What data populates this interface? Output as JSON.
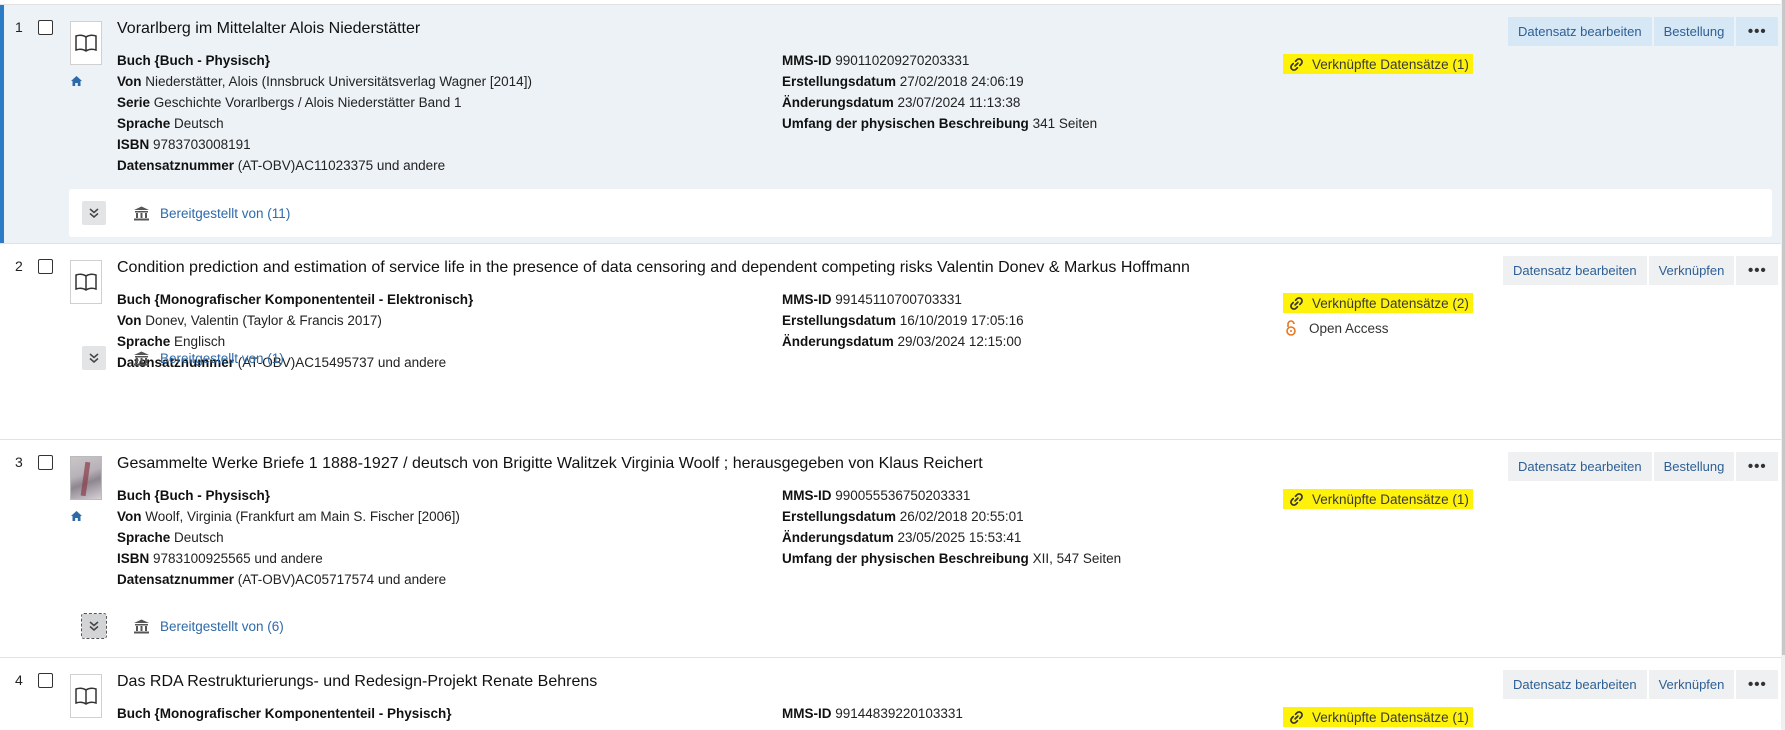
{
  "records": [
    {
      "number": "1",
      "title": "Vorarlberg im Mittelalter Alois Niederstätter",
      "left_fields": [
        {
          "label": "Buch {Buch - Physisch}",
          "value": ""
        },
        {
          "label": "Von",
          "value": "Niederstätter, Alois (Innsbruck Universitätsverlag Wagner [2014])"
        },
        {
          "label": "Serie",
          "value": "Geschichte Vorarlbergs / Alois Niederstätter Band 1"
        },
        {
          "label": "Sprache",
          "value": "Deutsch"
        },
        {
          "label": "ISBN",
          "value": "9783703008191"
        },
        {
          "label": "Datensatznummer",
          "value": "(AT-OBV)AC11023375 und andere"
        }
      ],
      "mid_fields": [
        {
          "label": "MMS-ID",
          "value": "990110209270203331"
        },
        {
          "label": "Erstellungsdatum",
          "value": "27/02/2018 24:06:19"
        },
        {
          "label": "Änderungsdatum",
          "value": "23/07/2024 11:13:38"
        },
        {
          "label": "Umfang der physischen Beschreibung",
          "value": "341 Seiten"
        }
      ],
      "linked": "Verknüpfte Datensätze (1)",
      "actions": [
        "Datensatz bearbeiten",
        "Bestellung",
        "•••"
      ],
      "provided_by": "Bereitgestellt von (11)"
    },
    {
      "number": "2",
      "title": "Condition prediction and estimation of service life in the presence of data censoring and dependent competing risks Valentin Donev & Markus Hoffmann",
      "left_fields": [
        {
          "label": "Buch {Monografischer Komponententeil - Elektronisch}",
          "value": ""
        },
        {
          "label": "Von",
          "value": "Donev, Valentin (Taylor & Francis 2017)"
        },
        {
          "label": "Sprache",
          "value": "Englisch"
        },
        {
          "label": "Datensatznummer",
          "value": "(AT-OBV)AC15495737 und andere"
        }
      ],
      "mid_fields": [
        {
          "label": "MMS-ID",
          "value": "99145110700703331"
        },
        {
          "label": "Erstellungsdatum",
          "value": "16/10/2019 17:05:16"
        },
        {
          "label": "Änderungsdatum",
          "value": "29/03/2024 12:15:00"
        }
      ],
      "linked": "Verknüpfte Datensätze (2)",
      "open_access": "Open Access",
      "actions": [
        "Datensatz bearbeiten",
        "Verknüpfen",
        "•••"
      ],
      "provided_by": "Bereitgestellt von (1)"
    },
    {
      "number": "3",
      "title": "Gesammelte Werke Briefe 1 1888-1927 / deutsch von Brigitte Walitzek Virginia Woolf ; herausgegeben von Klaus Reichert",
      "left_fields": [
        {
          "label": "Buch {Buch - Physisch}",
          "value": ""
        },
        {
          "label": "Von",
          "value": "Woolf, Virginia (Frankfurt am Main S. Fischer [2006])"
        },
        {
          "label": "Sprache",
          "value": "Deutsch"
        },
        {
          "label": "ISBN",
          "value": "9783100925565 und andere"
        },
        {
          "label": "Datensatznummer",
          "value": "(AT-OBV)AC05717574 und andere"
        }
      ],
      "mid_fields": [
        {
          "label": "MMS-ID",
          "value": "990055536750203331"
        },
        {
          "label": "Erstellungsdatum",
          "value": "26/02/2018 20:55:01"
        },
        {
          "label": "Änderungsdatum",
          "value": "23/05/2025 15:53:41"
        },
        {
          "label": "Umfang der physischen Beschreibung",
          "value": "XII, 547 Seiten"
        }
      ],
      "linked": "Verknüpfte Datensätze (1)",
      "actions": [
        "Datensatz bearbeiten",
        "Bestellung",
        "•••"
      ],
      "provided_by": "Bereitgestellt von (6)"
    },
    {
      "number": "4",
      "title": "Das RDA Restrukturierungs- und Redesign-Projekt Renate Behrens",
      "left_fields": [
        {
          "label": "Buch {Monografischer Komponententeil - Physisch}",
          "value": ""
        }
      ],
      "mid_fields": [
        {
          "label": "MMS-ID",
          "value": "99144839220103331"
        }
      ],
      "linked": "Verknüpfte Datensätze (1)",
      "actions": [
        "Datensatz bearbeiten",
        "Verknüpfen",
        "•••"
      ]
    }
  ],
  "colors": {
    "selected_bg": "#edf2f6",
    "accent_bar": "#2b7bc7",
    "highlight": "#fff20a",
    "link": "#2e6aa8",
    "open_access": "#e8761e"
  },
  "icons": [
    "book-icon",
    "book-cover-thumbnail",
    "home-icon",
    "link-icon",
    "open-lock-icon",
    "double-chevron-down-icon",
    "institution-icon"
  ]
}
